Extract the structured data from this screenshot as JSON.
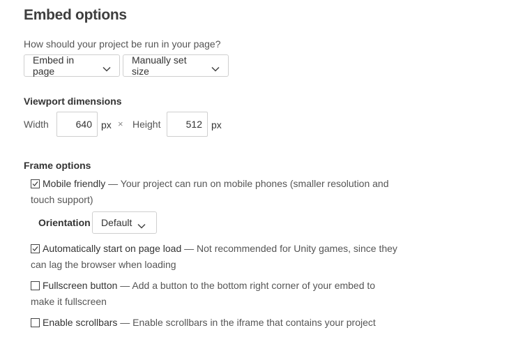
{
  "title": "Embed options",
  "run_mode": {
    "question": "How should your project be run in your page?",
    "embed_select": {
      "value": "Embed in page",
      "icon": "chevron-down-icon"
    },
    "size_select": {
      "value": "Manually set size",
      "icon": "chevron-down-icon"
    }
  },
  "viewport": {
    "heading": "Viewport dimensions",
    "width_label": "Width",
    "width_value": "640",
    "width_unit": "px",
    "separator": "×",
    "height_label": "Height",
    "height_value": "512",
    "height_unit": "px"
  },
  "frame_options": {
    "heading": "Frame options",
    "items": [
      {
        "name": "Mobile friendly",
        "description": " — Your project can run on mobile phones (smaller resolution and touch support)",
        "checked": true
      },
      {
        "name": "Automatically start on page load",
        "description": " — Not recommended for Unity games, since they can lag the browser when loading",
        "checked": true
      },
      {
        "name": "Fullscreen button",
        "description": " — Add a button to the bottom right corner of your embed to make it fullscreen",
        "checked": false
      },
      {
        "name": "Enable scrollbars",
        "description": " — Enable scrollbars in the iframe that contains your project",
        "checked": false
      }
    ],
    "orientation": {
      "label": "Orientation",
      "value": "Default",
      "icon": "chevron-down-icon"
    }
  }
}
